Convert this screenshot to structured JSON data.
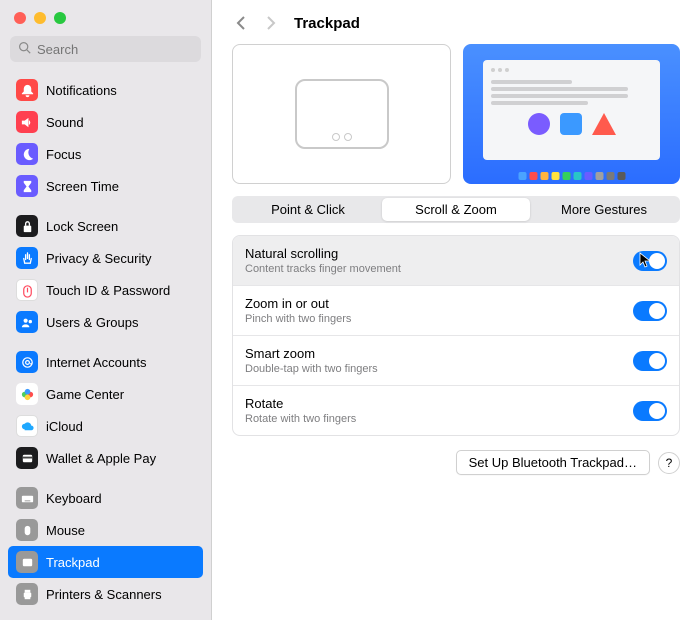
{
  "header": {
    "title": "Trackpad"
  },
  "search": {
    "placeholder": "Search"
  },
  "sidebar": {
    "group1": [
      {
        "label": "Notifications",
        "bg": "#ff4947",
        "glyph": "bell"
      },
      {
        "label": "Sound",
        "bg": "#ff4050",
        "glyph": "speaker"
      },
      {
        "label": "Focus",
        "bg": "#6a5cff",
        "glyph": "moon"
      },
      {
        "label": "Screen Time",
        "bg": "#6a5cff",
        "glyph": "hourglass"
      }
    ],
    "group2": [
      {
        "label": "Lock Screen",
        "bg": "#1c1c1e",
        "glyph": "lock"
      },
      {
        "label": "Privacy & Security",
        "bg": "#0a7aff",
        "glyph": "hand"
      },
      {
        "label": "Touch ID & Password",
        "bg": "#ffffff",
        "glyph": "finger",
        "fg": "#ff4a5f",
        "border": "#ddd"
      },
      {
        "label": "Users & Groups",
        "bg": "#0a7aff",
        "glyph": "users"
      }
    ],
    "group3": [
      {
        "label": "Internet Accounts",
        "bg": "#0a7aff",
        "glyph": "at"
      },
      {
        "label": "Game Center",
        "bg": "#ffffff",
        "glyph": "game"
      },
      {
        "label": "iCloud",
        "bg": "#ffffff",
        "glyph": "cloud",
        "fg": "#1fa8ff",
        "border": "#ddd"
      },
      {
        "label": "Wallet & Apple Pay",
        "bg": "#1c1c1e",
        "glyph": "wallet"
      }
    ],
    "group4": [
      {
        "label": "Keyboard",
        "bg": "#999999",
        "glyph": "keyboard"
      },
      {
        "label": "Mouse",
        "bg": "#999999",
        "glyph": "mouse"
      },
      {
        "label": "Trackpad",
        "bg": "#999999",
        "glyph": "trackpad",
        "selected": true
      },
      {
        "label": "Printers & Scanners",
        "bg": "#999999",
        "glyph": "printer"
      }
    ]
  },
  "tabs": [
    {
      "label": "Point & Click"
    },
    {
      "label": "Scroll & Zoom",
      "active": true
    },
    {
      "label": "More Gestures"
    }
  ],
  "options": [
    {
      "title": "Natural scrolling",
      "sub": "Content tracks finger movement",
      "on": true,
      "hover": true
    },
    {
      "title": "Zoom in or out",
      "sub": "Pinch with two fingers",
      "on": true
    },
    {
      "title": "Smart zoom",
      "sub": "Double-tap with two fingers",
      "on": true
    },
    {
      "title": "Rotate",
      "sub": "Rotate with two fingers",
      "on": true
    }
  ],
  "footer": {
    "setup": "Set Up Bluetooth Trackpad…",
    "help": "?"
  },
  "dock_colors": [
    "#4aa3ff",
    "#ff4d4d",
    "#ffb43d",
    "#ffe23d",
    "#35d05a",
    "#29c6c6",
    "#6a5cff",
    "#a0a0a0",
    "#7a7a7a",
    "#5a5a5a"
  ]
}
